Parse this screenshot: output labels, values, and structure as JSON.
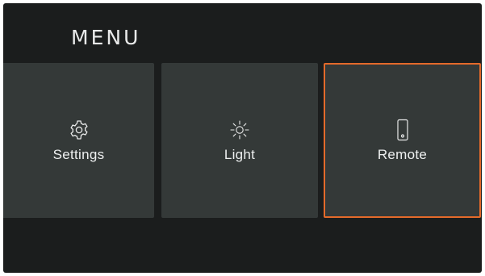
{
  "menu": {
    "title": "MENU"
  },
  "tiles": [
    {
      "label": "Settings",
      "icon": "gear-icon",
      "selected": false
    },
    {
      "label": "Light",
      "icon": "sun-icon",
      "selected": false
    },
    {
      "label": "Remote",
      "icon": "phone-remote-icon",
      "selected": true
    }
  ],
  "colors": {
    "background": "#1b1d1d",
    "tile": "#343938",
    "accent": "#e46a2a",
    "text": "#eef0f0"
  }
}
